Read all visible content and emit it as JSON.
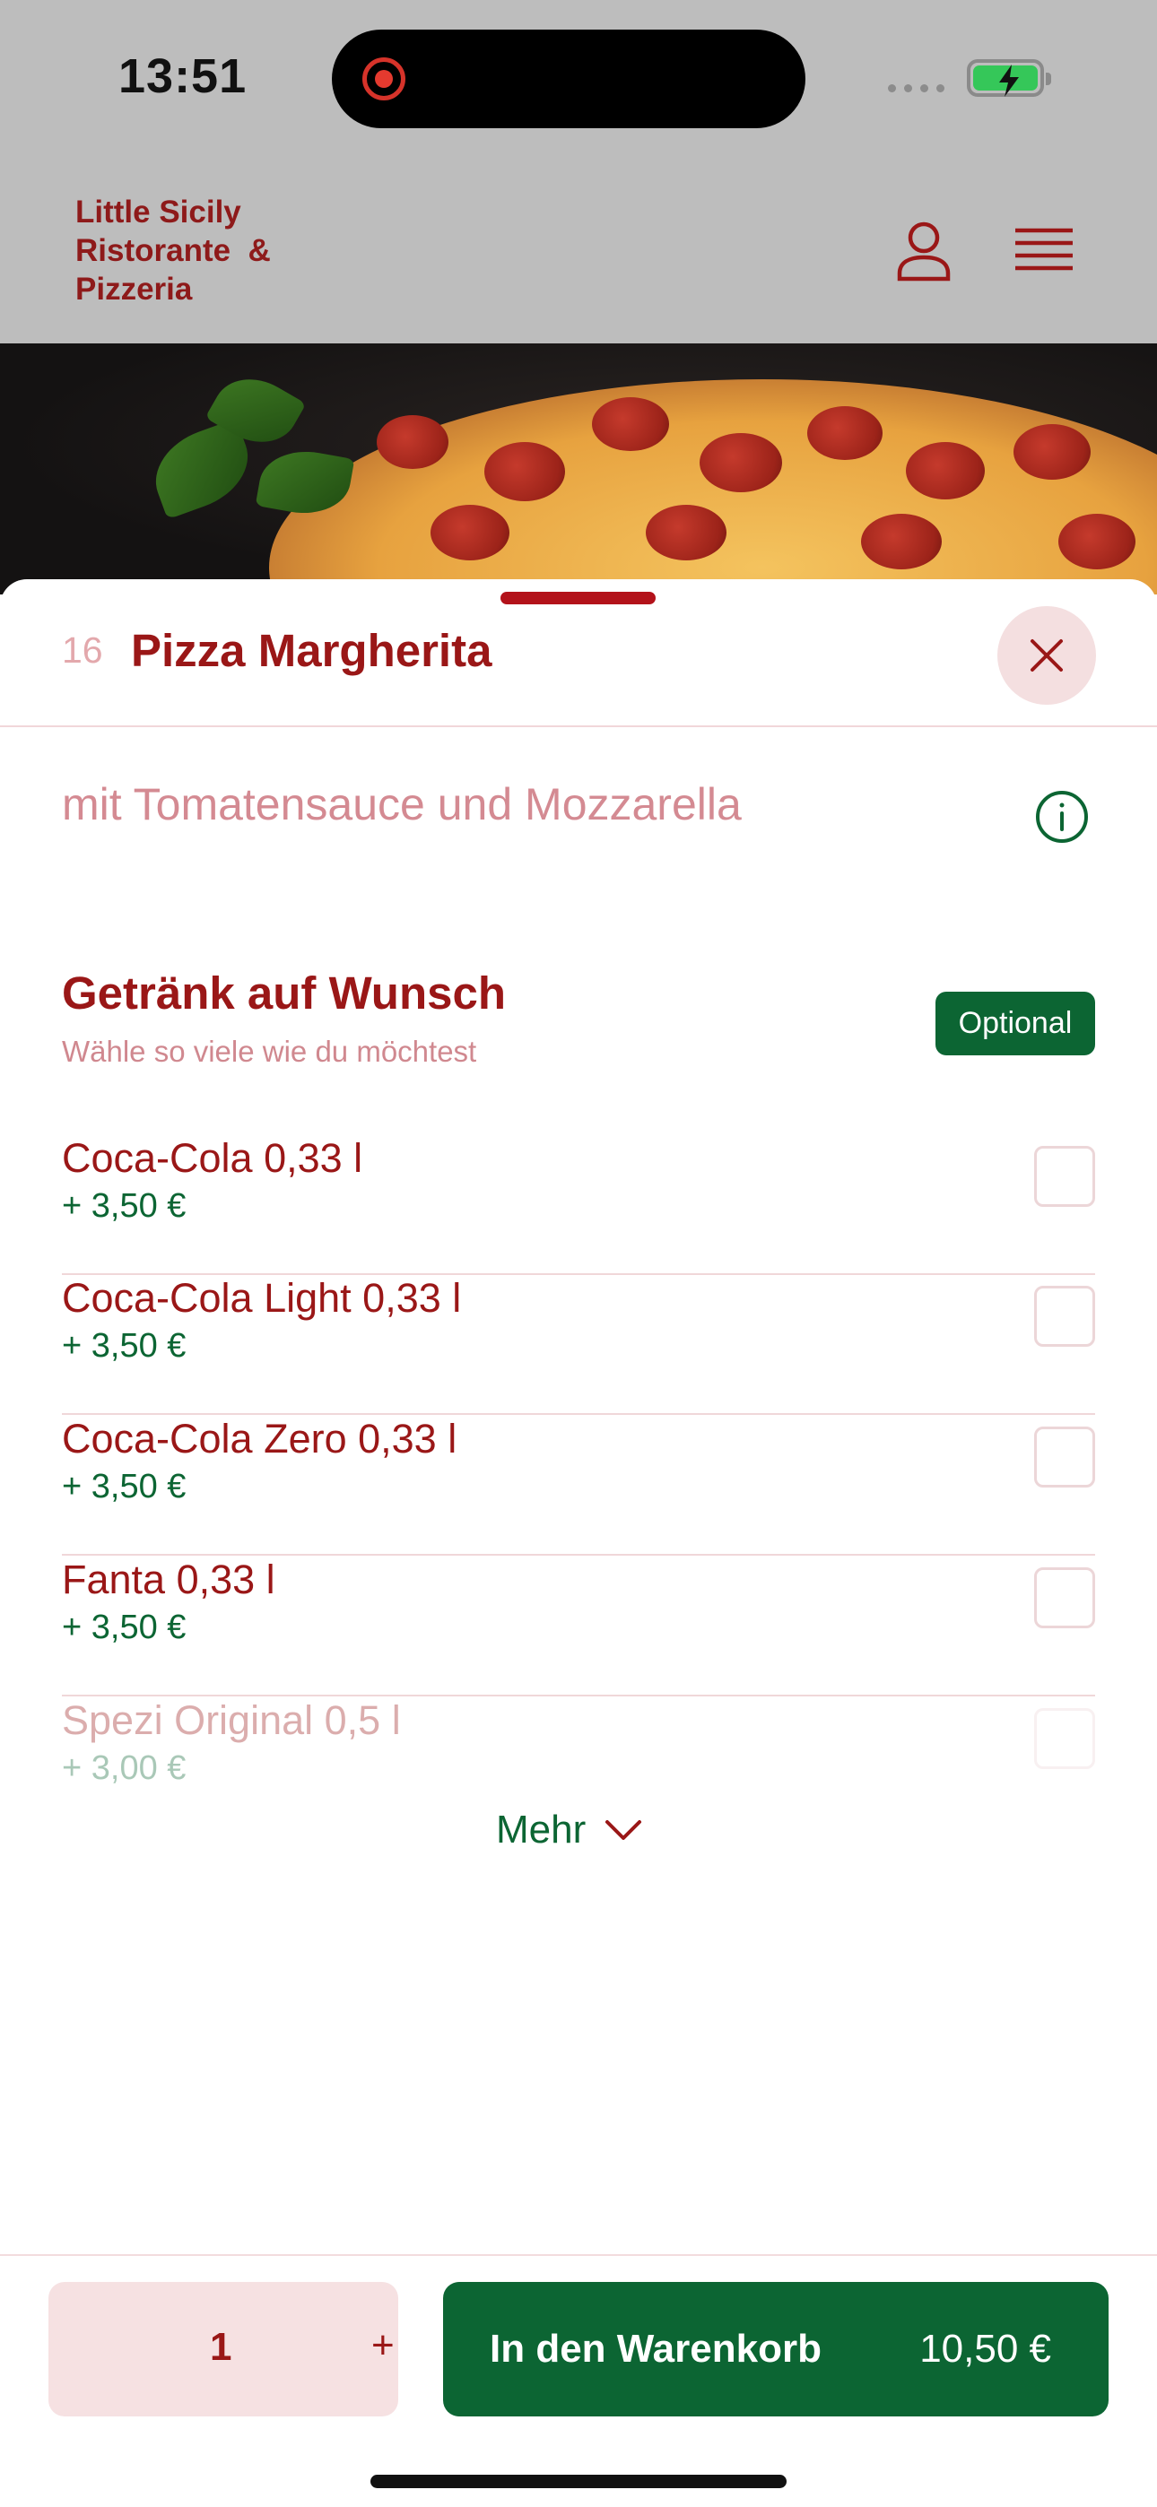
{
  "status_bar": {
    "time": "13:51"
  },
  "header": {
    "brand_line1": "Little Sicily",
    "brand_line2": "Ristorante  &",
    "brand_line3": "Pizzeria",
    "icons": [
      "user-icon",
      "menu-icon"
    ]
  },
  "item": {
    "number": "16",
    "title": "Pizza Margherita",
    "description": "mit Tomatensauce und Mozzarella"
  },
  "group": {
    "title": "Getränk auf Wunsch",
    "subtitle": "Wähle so viele wie du möchtest",
    "badge": "Optional",
    "options": [
      {
        "name": "Coca-Cola 0,33 l",
        "price": "+ 3,50 €"
      },
      {
        "name": "Coca-Cola Light 0,33 l",
        "price": "+ 3,50 €"
      },
      {
        "name": "Coca-Cola Zero 0,33 l",
        "price": "+ 3,50 €"
      },
      {
        "name": "Fanta 0,33 l",
        "price": "+ 3,50 €"
      },
      {
        "name": "Spezi Original 0,5 l",
        "price": "+ 3,00 €"
      }
    ],
    "more_label": "Mehr"
  },
  "footer": {
    "quantity": "1",
    "plus": "+",
    "cart_label": "In den Warenkorb",
    "cart_amount": "10,50 €"
  },
  "colors": {
    "brand_red": "#9a1717",
    "brand_green": "#0c6533"
  }
}
